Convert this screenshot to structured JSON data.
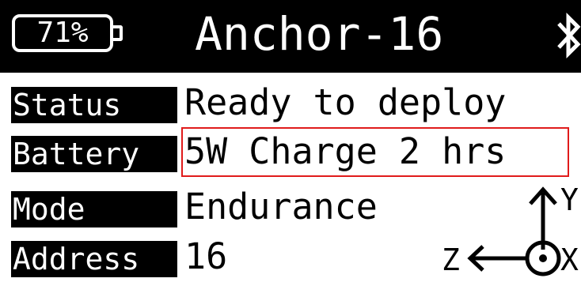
{
  "header": {
    "battery_percent": "71%",
    "device_name": "Anchor-16",
    "bluetooth_icon": "bluetooth-icon"
  },
  "rows": [
    {
      "label": "Status",
      "value": "Ready to deploy"
    },
    {
      "label": "Battery",
      "value": "5W Charge 2 hrs"
    },
    {
      "label": "Mode",
      "value": "Endurance"
    },
    {
      "label": "Address",
      "value": "16"
    }
  ],
  "axis": {
    "y_label": "Y",
    "z_label": "Z",
    "x_label": "X"
  },
  "colors": {
    "background": "#ffffff",
    "header": "#000000",
    "highlight": "#e01b1b"
  }
}
